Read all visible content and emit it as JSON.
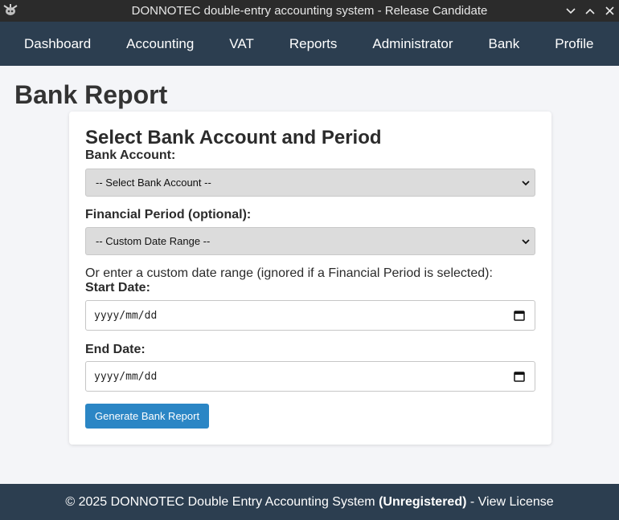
{
  "window": {
    "title": "DONNOTEC double-entry accounting system - Release Candidate",
    "icon": "app-logo-icon",
    "controls": [
      "chevron-down-icon",
      "chevron-up-icon",
      "close-icon"
    ]
  },
  "nav": {
    "items": [
      "Dashboard",
      "Accounting",
      "VAT",
      "Reports",
      "Administrator",
      "Bank",
      "Profile"
    ],
    "background": "#2c3e50"
  },
  "page": {
    "title": "Bank Report"
  },
  "form": {
    "heading": "Select Bank Account and Period",
    "bank_account_label": "Bank Account:",
    "bank_account_value": "-- Select Bank Account --",
    "period_label": "Financial Period (optional):",
    "period_value": "-- Custom Date Range --",
    "custom_hint": "Or enter a custom date range (ignored if a Financial Period is selected):",
    "start_label": "Start Date:",
    "start_placeholder": "yyyy/mm/dd",
    "end_label": "End Date:",
    "end_placeholder": "yyyy/mm/dd",
    "submit_label": "Generate Bank Report",
    "submit_color": "#2b86c5"
  },
  "footer": {
    "prefix": "© 2025 DONNOTEC Double Entry Accounting System ",
    "status": "(Unregistered)",
    "separator": " - ",
    "license_link": "View License"
  }
}
